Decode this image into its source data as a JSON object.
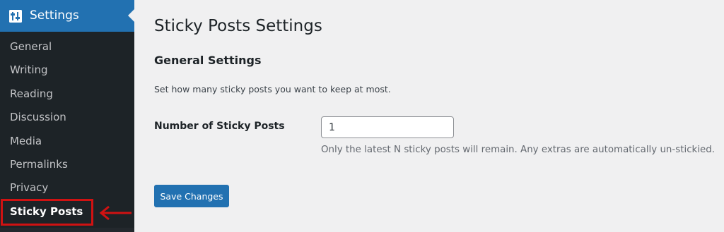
{
  "sidebar": {
    "section_title": "Settings",
    "section_icon": "settings-sliders-icon",
    "items": [
      {
        "label": "General"
      },
      {
        "label": "Writing"
      },
      {
        "label": "Reading"
      },
      {
        "label": "Discussion"
      },
      {
        "label": "Media"
      },
      {
        "label": "Permalinks"
      },
      {
        "label": "Privacy"
      },
      {
        "label": "Sticky Posts",
        "current": true
      }
    ]
  },
  "annotation": {
    "highlight_color": "#d01212",
    "arrow_icon": "left-arrow-icon"
  },
  "main": {
    "page_title": "Sticky Posts Settings",
    "section_title": "General Settings",
    "section_description": "Set how many sticky posts you want to keep at most.",
    "field": {
      "label": "Number of Sticky Posts",
      "value": "1",
      "description": "Only the latest N sticky posts will remain. Any extras are automatically un-stickied."
    },
    "save_label": "Save Changes"
  },
  "colors": {
    "accent": "#2271b1",
    "sidebar_bg": "#1d2327",
    "page_bg": "#f0f0f1"
  }
}
